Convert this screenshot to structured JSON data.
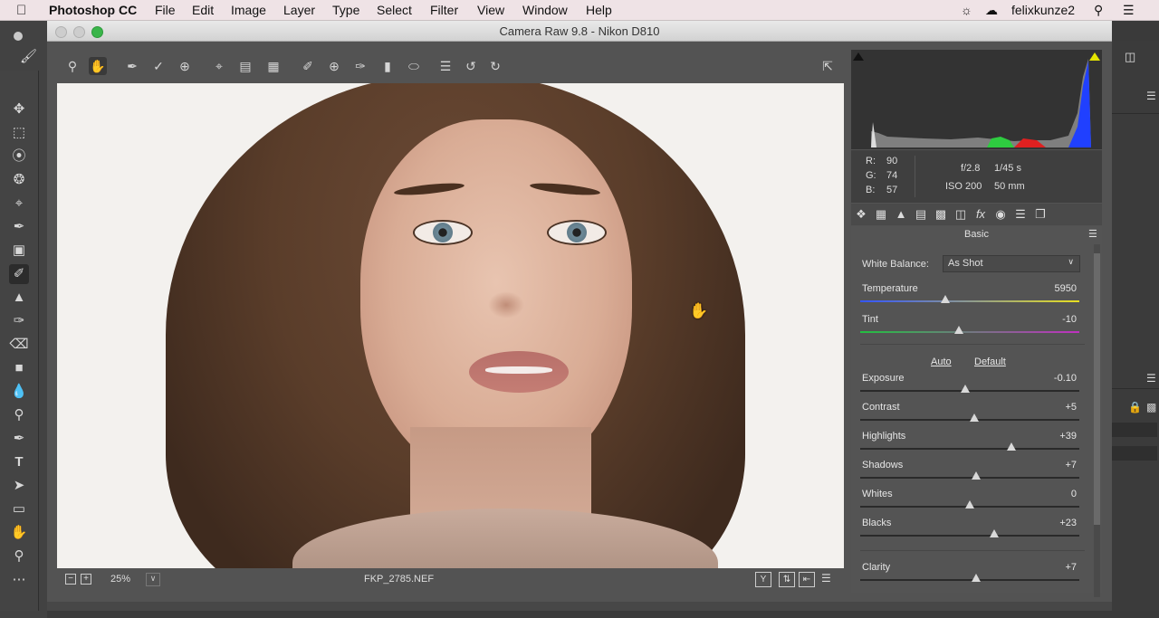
{
  "menubar": {
    "app_name": "Photoshop CC",
    "menus": [
      "File",
      "Edit",
      "Image",
      "Layer",
      "Type",
      "Select",
      "Filter",
      "View",
      "Window",
      "Help"
    ],
    "user": "felixkunze2"
  },
  "dialog": {
    "title": "Camera Raw 9.8  -  Nikon D810"
  },
  "status": {
    "zoom": "25%",
    "filename": "FKP_2785.NEF"
  },
  "info": {
    "r_label": "R:",
    "r_value": "90",
    "g_label": "G:",
    "g_value": "74",
    "b_label": "B:",
    "b_value": "57",
    "aperture": "f/2.8",
    "shutter": "1/45 s",
    "iso": "ISO 200",
    "focal": "50 mm"
  },
  "panel": {
    "title": "Basic",
    "white_balance_label": "White Balance:",
    "white_balance_value": "As Shot",
    "auto_label": "Auto",
    "default_label": "Default",
    "sliders": [
      {
        "label": "Temperature",
        "value": "5950",
        "fraction": 0.39
      },
      {
        "label": "Tint",
        "value": "-10",
        "fraction": 0.45
      },
      {
        "label": "Exposure",
        "value": "-0.10",
        "fraction": 0.48
      },
      {
        "label": "Contrast",
        "value": "+5",
        "fraction": 0.52
      },
      {
        "label": "Highlights",
        "value": "+39",
        "fraction": 0.69
      },
      {
        "label": "Shadows",
        "value": "+7",
        "fraction": 0.53
      },
      {
        "label": "Whites",
        "value": "0",
        "fraction": 0.5
      },
      {
        "label": "Blacks",
        "value": "+23",
        "fraction": 0.61
      },
      {
        "label": "Clarity",
        "value": "+7",
        "fraction": 0.53
      }
    ]
  },
  "colors": {
    "menubar_bg": "#efe3e6",
    "dialog_bg": "#535353",
    "panel_bg": "#545454",
    "traffic_close": "#c9c9c9",
    "traffic_zoom": "#3ab54a"
  }
}
